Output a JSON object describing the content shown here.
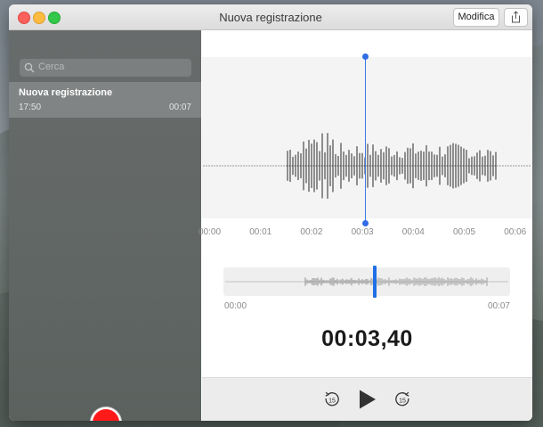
{
  "window": {
    "title": "Nuova registrazione"
  },
  "toolbar": {
    "edit_label": "Modifica",
    "share_icon": "share-icon"
  },
  "sidebar": {
    "search": {
      "placeholder": "Cerca"
    },
    "recordings": [
      {
        "name": "Nuova registrazione",
        "time": "17:50",
        "duration": "00:07",
        "selected": true
      }
    ]
  },
  "waveform": {
    "tick_labels": [
      "00:00",
      "00:01",
      "00:02",
      "00:03",
      "00:04",
      "00:05",
      "00:06"
    ],
    "overview_start": "00:00",
    "overview_end": "00:07"
  },
  "playback": {
    "current_time": "00:03,40",
    "skip_back_seconds": "15",
    "skip_forward_seconds": "15"
  },
  "colors": {
    "accent": "#2f6de5",
    "record": "#ff1a1a"
  }
}
